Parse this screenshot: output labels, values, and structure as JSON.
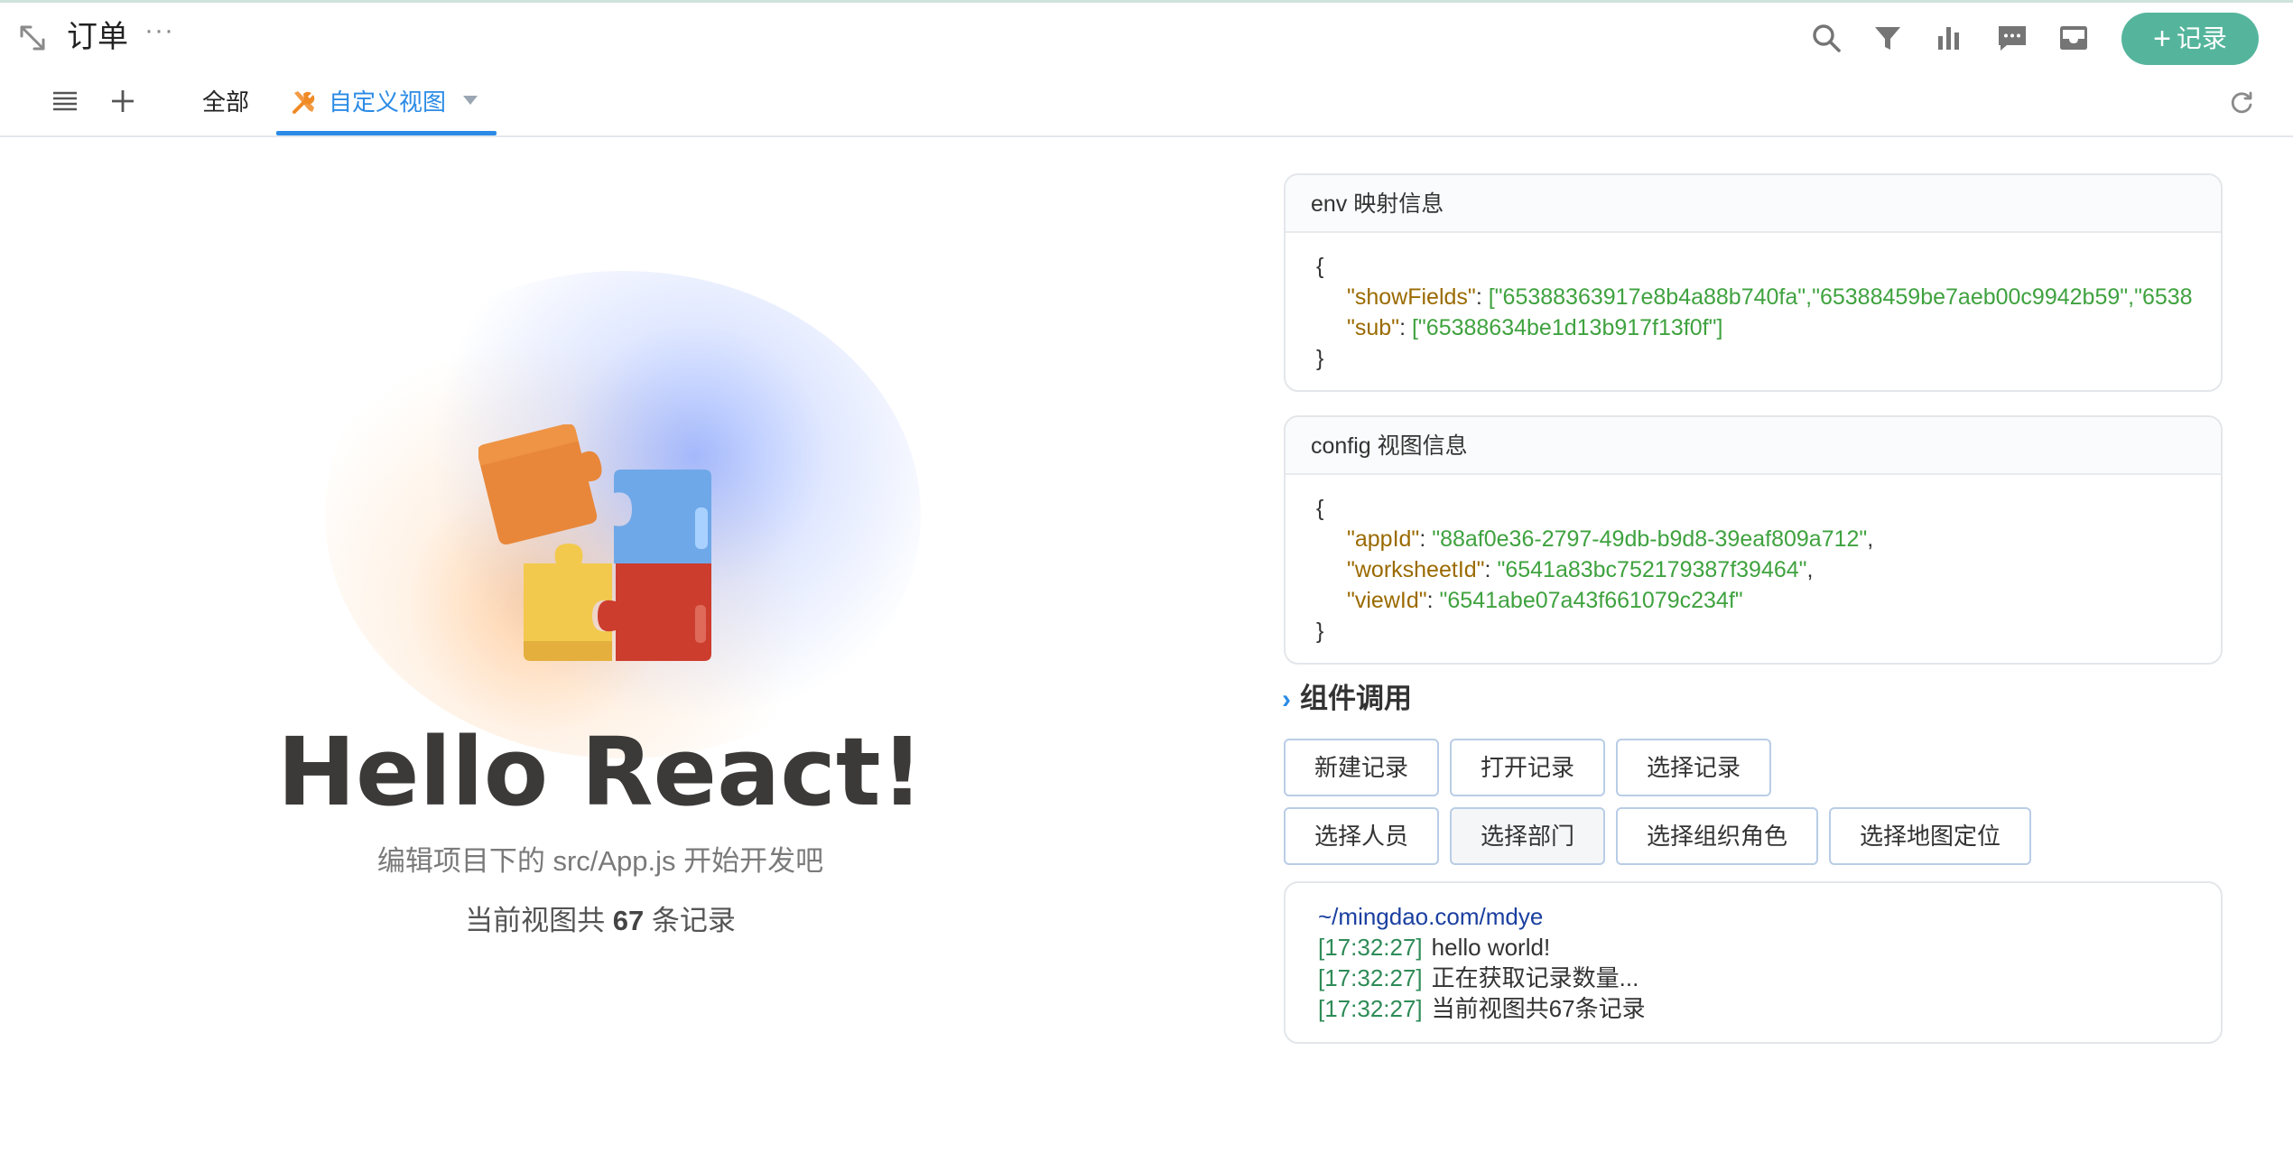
{
  "header": {
    "title": "订单",
    "more": "···",
    "add_record_label": "记录"
  },
  "tabs": {
    "all_label": "全部",
    "custom_label": "自定义视图"
  },
  "hero": {
    "headline": "Hello React!",
    "hint": "编辑项目下的 src/App.js 开始开发吧",
    "count_prefix": "当前视图共 ",
    "count_value": "67",
    "count_suffix": " 条记录"
  },
  "env_panel": {
    "title": "env 映射信息",
    "open_brace": "{",
    "close_brace": "}",
    "show_fields_key": "\"showFields\"",
    "show_fields_value": "[\"65388363917e8b4a88b740fa\",\"65388459be7aeb00c9942b59\",\"6538",
    "sub_key": "\"sub\"",
    "sub_value": "[\"65388634be1d13b917f13f0f\"]"
  },
  "config_panel": {
    "title": "config 视图信息",
    "open_brace": "{",
    "close_brace": "}",
    "app_id_key": "\"appId\"",
    "app_id_value": "\"88af0e36-2797-49db-b9d8-39eaf809a712\"",
    "worksheet_id_key": "\"worksheetId\"",
    "worksheet_id_value": "\"6541a83bc752179387f39464\"",
    "view_id_key": "\"viewId\"",
    "view_id_value": "\"6541abe07a43f661079c234f\""
  },
  "components": {
    "title": "组件调用",
    "buttons_row1": [
      "新建记录",
      "打开记录",
      "选择记录"
    ],
    "buttons_row2": [
      "选择人员",
      "选择部门",
      "选择组织角色",
      "选择地图定位"
    ]
  },
  "log": {
    "path": "~/mingdao.com/mdye",
    "entries": [
      {
        "time": "[17:32:27]",
        "text": "hello world!"
      },
      {
        "time": "[17:32:27]",
        "text": "正在获取记录数量..."
      },
      {
        "time": "[17:32:27]",
        "text": "当前视图共67条记录"
      }
    ]
  },
  "colors": {
    "accent_blue": "#2b8be6",
    "add_button_green": "#55b59c",
    "json_key": "#9a6a00",
    "json_value": "#3fa23f"
  }
}
